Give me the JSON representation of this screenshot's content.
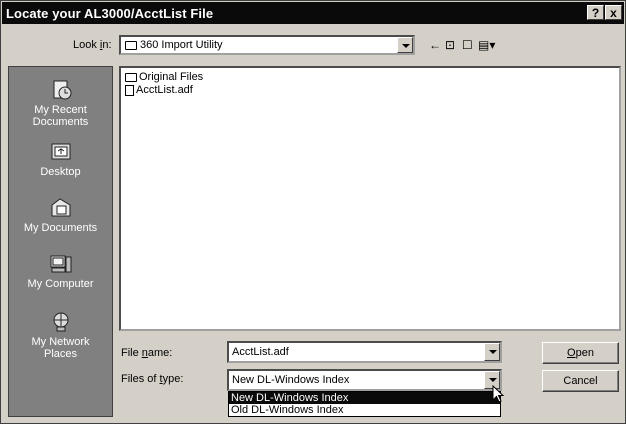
{
  "window": {
    "title": "Locate your AL3000/AcctList File",
    "help_label": "?",
    "close_label": "x"
  },
  "look_in": {
    "label_pre": "Look ",
    "label_accel": "i",
    "label_post": "n:",
    "value": "360 Import Utility"
  },
  "toolbar": {
    "back_glyph": "←",
    "up_glyph": "⊡",
    "newfolder_glyph": "☐",
    "view_glyph": "▤▾"
  },
  "places": [
    {
      "label": "My Recent\nDocuments",
      "icon": "recent-documents-icon"
    },
    {
      "label": "Desktop",
      "icon": "desktop-icon"
    },
    {
      "label": "My Documents",
      "icon": "my-documents-icon"
    },
    {
      "label": "My Computer",
      "icon": "my-computer-icon"
    },
    {
      "label": "My Network\nPlaces",
      "icon": "network-places-icon"
    }
  ],
  "files": [
    {
      "name": "Original Files",
      "type": "folder"
    },
    {
      "name": "AcctList.adf",
      "type": "file"
    }
  ],
  "file_name": {
    "label_pre": "File ",
    "label_accel": "n",
    "label_post": "ame:",
    "value": "AcctList.adf"
  },
  "file_type": {
    "label_pre": "Files of ",
    "label_accel": "t",
    "label_post": "ype:",
    "value": "New DL-Windows Index",
    "options": [
      "New DL-Windows Index",
      "Old DL-Windows Index"
    ],
    "selected_index": 0
  },
  "buttons": {
    "open_accel": "O",
    "open_rest": "pen",
    "cancel": "Cancel"
  }
}
